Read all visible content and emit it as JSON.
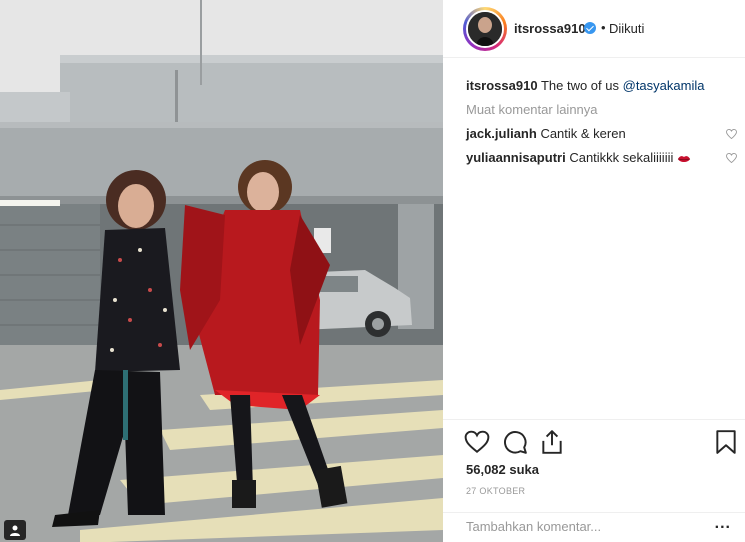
{
  "post": {
    "username": "itsrossa910",
    "separator": "•",
    "follow_state": "Diikuti",
    "caption_user": "itsrossa910",
    "caption_text": "The two of us",
    "caption_mention": "@tasyakamila",
    "more_comments": "Muat komentar lainnya",
    "comments": [
      {
        "user": "jack.julianh",
        "text": "Cantik & keren"
      },
      {
        "user": "yuliaannisaputri",
        "text": "Cantikkk sekaliiiiiii"
      }
    ],
    "likes": "56,082 suka",
    "date": "27 OKTOBER",
    "comment_placeholder": "Tambahkan komentar...",
    "more_options": "..."
  },
  "icons": {
    "like": "heart-icon",
    "comment": "comment-icon",
    "share": "share-icon",
    "save": "bookmark-icon",
    "verified": "verified-badge-icon",
    "tagged": "user-tag-icon"
  },
  "colors": {
    "verified": "#3897f0",
    "text": "#262626",
    "muted": "#999999",
    "mention": "#003569",
    "dress_red": "#b8191e"
  }
}
